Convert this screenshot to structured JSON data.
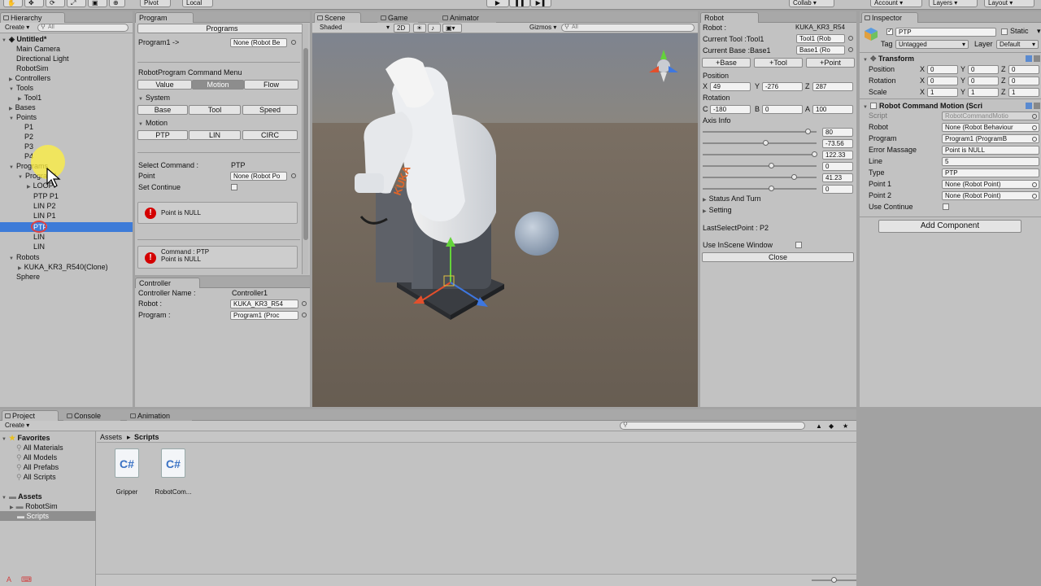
{
  "toolbar": {
    "pivot": "Pivot",
    "local": "Local",
    "collab": "Collab",
    "account": "Account",
    "layers": "Layers",
    "layout": "Layout"
  },
  "hierarchy": {
    "tab": "Hierarchy",
    "create": "Create",
    "search_placeholder": "All",
    "scene_name": "Untitled*",
    "items": {
      "main_camera": "Main Camera",
      "directional_light": "Directional Light",
      "robotsim": "RobotSim",
      "controllers": "Controllers",
      "tools": "Tools",
      "tool1": "Tool1",
      "bases": "Bases",
      "points": "Points",
      "p1": "P1",
      "p2": "P2",
      "p3": "P3",
      "p4": "P4",
      "programs": "Programs",
      "program1": "Program1",
      "loop": "LOOP",
      "ptp_p1": "PTP P1",
      "lin_p2": "LIN P2",
      "lin_p1": "LIN P1",
      "ptp": "PTP",
      "lin_a": "LIN",
      "lin_b": "LIN",
      "robots": "Robots",
      "kuka": "KUKA_KR3_R540(Clone)",
      "sphere": "Sphere"
    }
  },
  "program": {
    "tab": "Program",
    "programs_btn": "Programs",
    "program1_label": "Program1 ->",
    "program1_field": "None (Robot Be",
    "menu_title": "RobotProgram Command Menu",
    "menu_tabs": [
      "Value",
      "Motion",
      "Flow"
    ],
    "system_label": "System",
    "system_btns": [
      "Base",
      "Tool",
      "Speed"
    ],
    "motion_label": "Motion",
    "motion_btns": [
      "PTP",
      "LIN",
      "CIRC"
    ],
    "select_command_label": "Select Command :",
    "select_command_value": "PTP",
    "point_label": "Point",
    "point_field": "None (Robot Po",
    "set_continue_label": "Set Continue",
    "error1": "Point is NULL",
    "error2_line1": "Command : PTP",
    "error2_line2": "Point is NULL"
  },
  "controller": {
    "tab": "Controller",
    "name_label": "Controller Name :",
    "name_value": "Controller1",
    "robot_label": "Robot :",
    "robot_value": "KUKA_KR3_R54",
    "program_label": "Program :",
    "program_value": "Program1 (Proc"
  },
  "scene": {
    "tabs": [
      "Scene",
      "Game",
      "Animator"
    ],
    "shading": "Shaded",
    "mode_2d": "2D",
    "gizmos": "Gizmos",
    "search_placeholder": "All",
    "robot_brand": "KUKA"
  },
  "robot": {
    "tab": "Robot",
    "robot_label": "Robot :",
    "robot_value": "KUKA_KR3_R54",
    "tool_label": "Current Tool :Tool1",
    "tool_value": "Tool1 (Rob",
    "base_label": "Current Base :Base1",
    "base_value": "Base1 (Ro",
    "add_btns": [
      "+Base",
      "+Tool",
      "+Point"
    ],
    "position_label": "Position",
    "pos": {
      "x_label": "X",
      "x": "49",
      "y_label": "Y",
      "y": "-276",
      "z_label": "Z",
      "z": "287"
    },
    "rotation_label": "Rotation",
    "rot": {
      "c_label": "C",
      "c": "-180",
      "b_label": "B",
      "b": "0",
      "a_label": "A",
      "a": "100"
    },
    "axis_info_label": "Axis Info",
    "axes": [
      {
        "value": "80",
        "level": 0.92
      },
      {
        "value": "-73.56",
        "level": 0.55
      },
      {
        "value": "122.33",
        "level": 0.98
      },
      {
        "value": "0",
        "level": 0.6
      },
      {
        "value": "41.23",
        "level": 0.8
      },
      {
        "value": "0",
        "level": 0.6
      }
    ],
    "status_turn": "Status And Turn",
    "setting": "Setting",
    "last_select": "LastSelectPoint : P2",
    "use_inscene": "Use InScene Window",
    "close_btn": "Close"
  },
  "inspector": {
    "tab": "Inspector",
    "object_name": "PTP",
    "static_label": "Static",
    "tag_label": "Tag",
    "tag_value": "Untagged",
    "layer_label": "Layer",
    "layer_value": "Default",
    "transform_title": "Transform",
    "transform_rows": [
      {
        "label": "Position",
        "x": "0",
        "y": "0",
        "z": "0"
      },
      {
        "label": "Rotation",
        "x": "0",
        "y": "0",
        "z": "0"
      },
      {
        "label": "Scale",
        "x": "1",
        "y": "1",
        "z": "1"
      }
    ],
    "axis_letters": {
      "x": "X",
      "y": "Y",
      "z": "Z"
    },
    "component_title": "Robot Command Motion (Scri",
    "component_rows": [
      {
        "label": "Script",
        "value": "RobotCommandMotio"
      },
      {
        "label": "Robot",
        "value": "None (Robot Behaviour"
      },
      {
        "label": "Program",
        "value": "Program1 (ProgramB"
      },
      {
        "label": "Error Massage",
        "value": "Point is NULL"
      },
      {
        "label": "Line",
        "value": "5"
      },
      {
        "label": "Type",
        "value": "PTP"
      },
      {
        "label": "Point 1",
        "value": "None (Robot Point)"
      },
      {
        "label": "Point 2",
        "value": "None (Robot Point)"
      },
      {
        "label": "Use Continue",
        "value": ""
      }
    ],
    "add_component": "Add Component"
  },
  "project": {
    "tabs": [
      "Project",
      "Console",
      "Animation"
    ],
    "create": "Create",
    "favorites_label": "Favorites",
    "favorites": [
      "All Materials",
      "All Models",
      "All Prefabs",
      "All Scripts"
    ],
    "assets_label": "Assets",
    "assets": [
      "RobotSim",
      "Scripts"
    ],
    "breadcrumb": [
      "Assets",
      "Scripts"
    ],
    "files": [
      "Gripper",
      "RobotCom..."
    ],
    "file_glyph": "C#"
  },
  "colors": {
    "selection": "#3d7bd8",
    "error": "#d40000",
    "scene_sky": "#7b7f8a",
    "scene_ground": "#6b6156"
  }
}
